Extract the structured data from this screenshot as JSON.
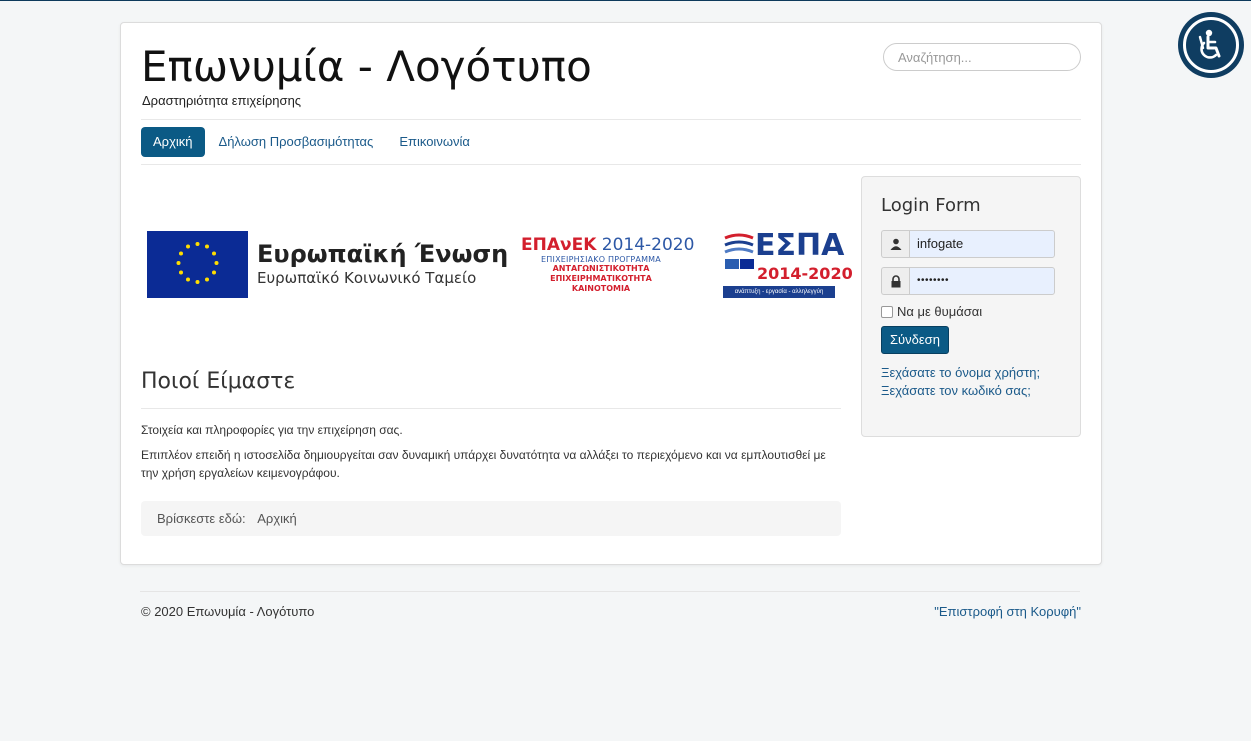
{
  "accessibility": {
    "icon": "wheelchair-icon"
  },
  "header": {
    "brand": "Επωνυμία - Λογότυπο",
    "tagline": "Δραστηριότητα επιχείρησης",
    "search_placeholder": "Αναζήτηση..."
  },
  "nav": {
    "items": [
      {
        "label": "Αρχική",
        "active": true
      },
      {
        "label": "Δήλωση Προσβασιμότητας",
        "active": false
      },
      {
        "label": "Επικοινωνία",
        "active": false
      }
    ]
  },
  "logos": {
    "eu_title": "Ευρωπαϊκή Ένωση",
    "eu_subtitle": "Ευρωπαϊκό Κοινωνικό Ταμείο",
    "epanek_name": "ΕΠΑνΕΚ",
    "epanek_years": "2014-2020",
    "epanek_line1": "ΕΠΙΧΕΙΡΗΣΙΑΚΟ ΠΡΟΓΡΑΜΜΑ",
    "epanek_line2": "ΑΝΤΑΓΩΝΙΣΤΙΚΟΤΗΤΑ",
    "epanek_line3": "ΕΠΙΧΕΙΡΗΜΑΤΙΚΟΤΗΤΑ",
    "epanek_line4": "ΚΑΙΝΟΤΟΜΙΑ",
    "espa_word": "ΕΣΠΑ",
    "espa_years": "2014-2020",
    "espa_bar": "ανάπτυξη - εργασία - αλληλεγγύη"
  },
  "main": {
    "title": "Ποιοί Είμαστε",
    "para1": "Στοιχεία και πληροφορίες για την επιχείρηση σας.",
    "para2": "Επιπλέον επειδή η ιστοσελίδα δημιουργείται σαν δυναμική υπάρχει δυνατότητα να αλλάξει το περιεχόμενο και να εμπλουτισθεί με την χρήση εργαλείων κειμενογράφου.",
    "breadcrumb_label": "Βρίσκεστε εδώ:",
    "breadcrumb_home": "Αρχική"
  },
  "login": {
    "title": "Login Form",
    "username": "infogate",
    "password_mask": "••••••••",
    "remember_label": "Να με θυμάσαι",
    "submit_label": "Σύνδεση",
    "forgot_username": "Ξεχάσατε το όνομα χρήστη;",
    "forgot_password": "Ξεχάσατε τον κωδικό σας;"
  },
  "footer": {
    "copyright": "© 2020 Επωνυμία - Λογότυπο",
    "back_to_top": "\"Επιστροφή στη Κορυφή\""
  }
}
